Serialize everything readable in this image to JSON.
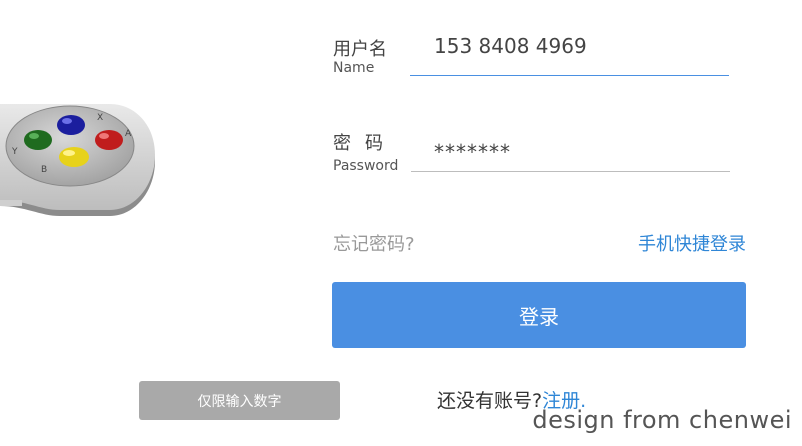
{
  "form": {
    "username": {
      "label_cn": "用户名",
      "label_en": "Name",
      "value": "153 8408 4969"
    },
    "password": {
      "label_cn": "密码",
      "label_en": "Password",
      "value": "*******"
    },
    "forgot_password": "忘记密码?",
    "quick_login": "手机快捷登录",
    "login_button": "登录",
    "no_account_text": "还没有账号?",
    "register_link": "注册."
  },
  "hint_badge": "仅限输入数字",
  "credit": "design from chenwei",
  "gamepad": {
    "button_labels": {
      "x": "X",
      "y": "Y",
      "a": "A",
      "b": "B"
    }
  },
  "colors": {
    "accent": "#4a90e2",
    "link": "#2f86d6",
    "badge_bg": "#a9a9a9"
  }
}
